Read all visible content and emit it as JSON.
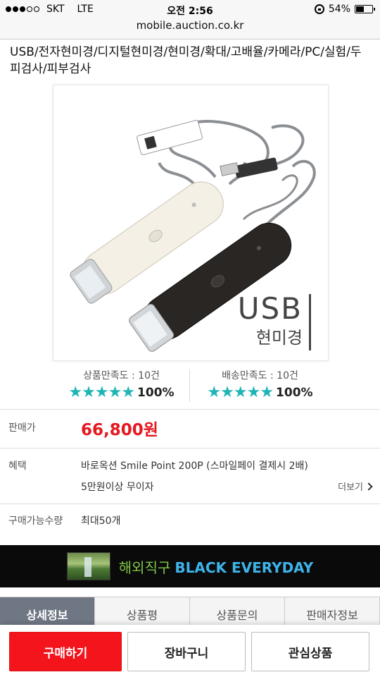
{
  "status_bar": {
    "carrier": "SKT",
    "network": "LTE",
    "time": "오전 2:56",
    "battery": "54%",
    "battery_level": 0.54,
    "url": "mobile.auction.co.kr"
  },
  "product": {
    "title": "USB/전자현미경/디지털현미경/현미경/확대/고배율/카메라/PC/실험/두피검사/피부검사",
    "image_text": {
      "main": "USB",
      "sub": "현미경"
    }
  },
  "satisfaction": {
    "product": {
      "label": "상품만족도 : 10건",
      "stars": 5,
      "percent": "100%"
    },
    "delivery": {
      "label": "배송만족도 : 10건",
      "stars": 5,
      "percent": "100%"
    }
  },
  "info": {
    "price_label": "판매가",
    "price": "66,800원",
    "benefit_label": "혜택",
    "benefit_line1": "바로옥션 Smile Point 200P (스마일페이 결제시 2배)",
    "benefit_line2": "5만원이상 무이자",
    "more": "더보기",
    "qty_label": "구매가능수량",
    "qty_value": "최대50개"
  },
  "banner": {
    "kr_text": "해외직구",
    "en_text": "BLACK EVERYDAY"
  },
  "tabs": [
    {
      "label": "상세정보",
      "active": true
    },
    {
      "label": "상품평",
      "active": false
    },
    {
      "label": "상품문의",
      "active": false
    },
    {
      "label": "판매자정보",
      "active": false
    }
  ],
  "actions": {
    "buy": "구매하기",
    "cart": "장바구니",
    "wish": "관심상품"
  },
  "colors": {
    "accent_red": "#e5171f",
    "star_teal": "#20b5b5",
    "tab_active": "#707784"
  }
}
